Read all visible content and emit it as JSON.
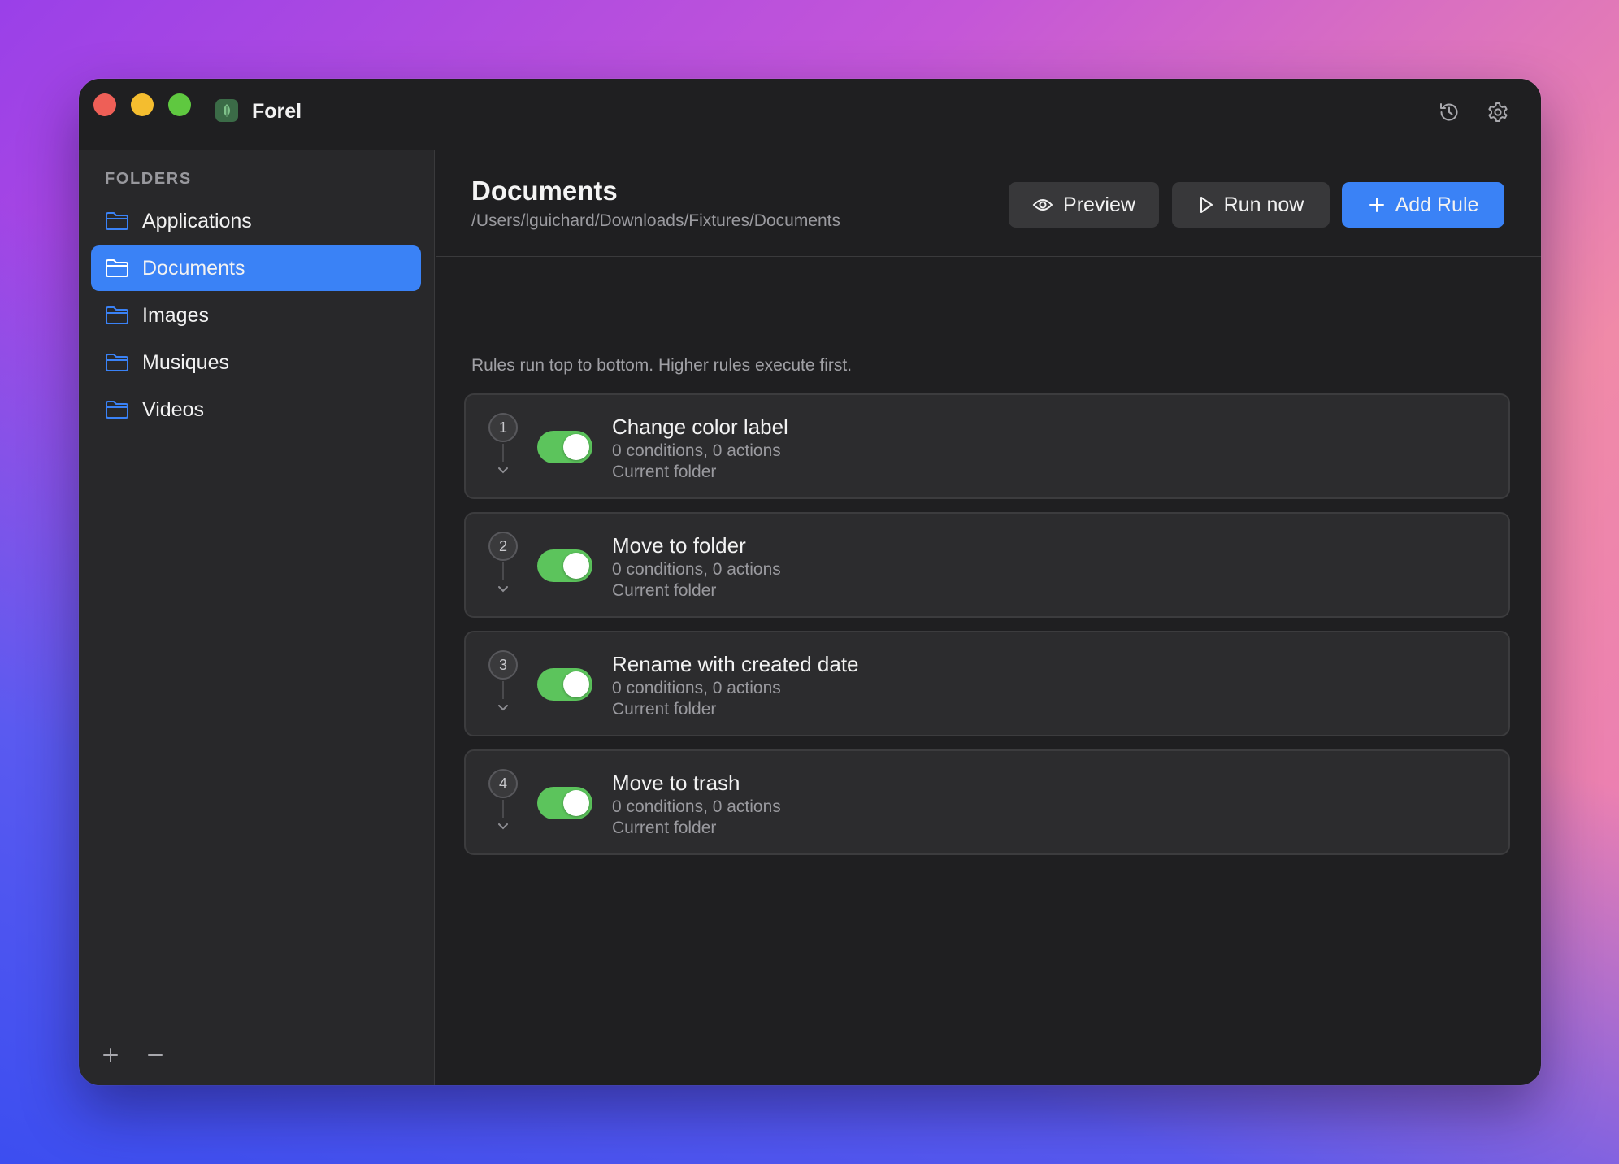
{
  "window": {
    "app_title": "Forel",
    "icons": {
      "history": "history-icon",
      "settings": "gear-icon"
    }
  },
  "sidebar": {
    "heading": "FOLDERS",
    "folders": [
      {
        "label": "Applications",
        "selected": false
      },
      {
        "label": "Documents",
        "selected": true
      },
      {
        "label": "Images",
        "selected": false
      },
      {
        "label": "Musiques",
        "selected": false
      },
      {
        "label": "Videos",
        "selected": false
      }
    ],
    "footer": {
      "add_icon": "plus-icon",
      "remove_icon": "minus-icon"
    }
  },
  "main": {
    "title": "Documents",
    "path": "/Users/lguichard/Downloads/Fixtures/Documents",
    "buttons": {
      "preview": "Preview",
      "run": "Run now",
      "add": "Add Rule"
    },
    "hint": "Rules run top to bottom. Higher rules execute first.",
    "rules": [
      {
        "index": "1",
        "title": "Change color label",
        "meta": "0 conditions, 0 actions",
        "scope": "Current folder",
        "enabled": true
      },
      {
        "index": "2",
        "title": "Move to folder",
        "meta": "0 conditions, 0 actions",
        "scope": "Current folder",
        "enabled": true
      },
      {
        "index": "3",
        "title": "Rename with created date",
        "meta": "0 conditions, 0 actions",
        "scope": "Current folder",
        "enabled": true
      },
      {
        "index": "4",
        "title": "Move to trash",
        "meta": "0 conditions, 0 actions",
        "scope": "Current folder",
        "enabled": true
      }
    ]
  },
  "colors": {
    "accent": "#3a82f6",
    "toggle_on": "#5cc45c",
    "window_bg": "#1f1f21",
    "sidebar_bg": "#28282a"
  }
}
